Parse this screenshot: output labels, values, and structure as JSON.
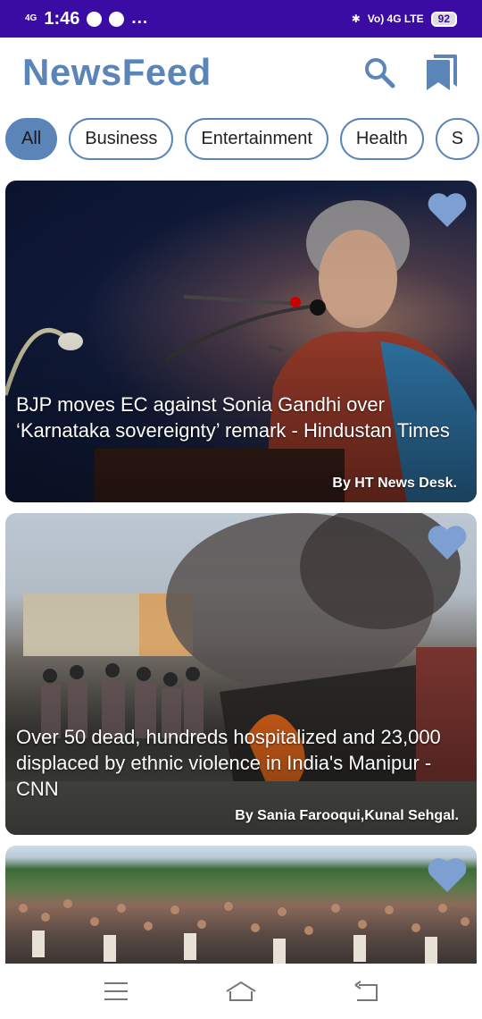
{
  "status_bar": {
    "signal": "4G",
    "time": "1:46",
    "dots": "...",
    "network": "Vo) 4G LTE",
    "battery": "92"
  },
  "app": {
    "title": "NewsFeed",
    "accent_color": "#5b84b8",
    "actions": [
      "search-icon",
      "bookmarks-icon"
    ]
  },
  "categories": [
    "All",
    "Business",
    "Entertainment",
    "Health",
    "S"
  ],
  "selected_category": "All",
  "articles": [
    {
      "headline": "BJP moves EC against Sonia Gandhi over ‘Karnataka sovereignty’ remark - Hindustan Times",
      "author": "By HT News Desk."
    },
    {
      "headline": "Over 50 dead, hundreds hospitalized and 23,000 displaced by ethnic violence in India's Manipur - CNN",
      "author": "By Sania Farooqui,Kunal Sehgal."
    },
    {
      "headline": "",
      "author": ""
    }
  ],
  "nav": [
    "menu-icon",
    "home-icon",
    "back-icon"
  ]
}
